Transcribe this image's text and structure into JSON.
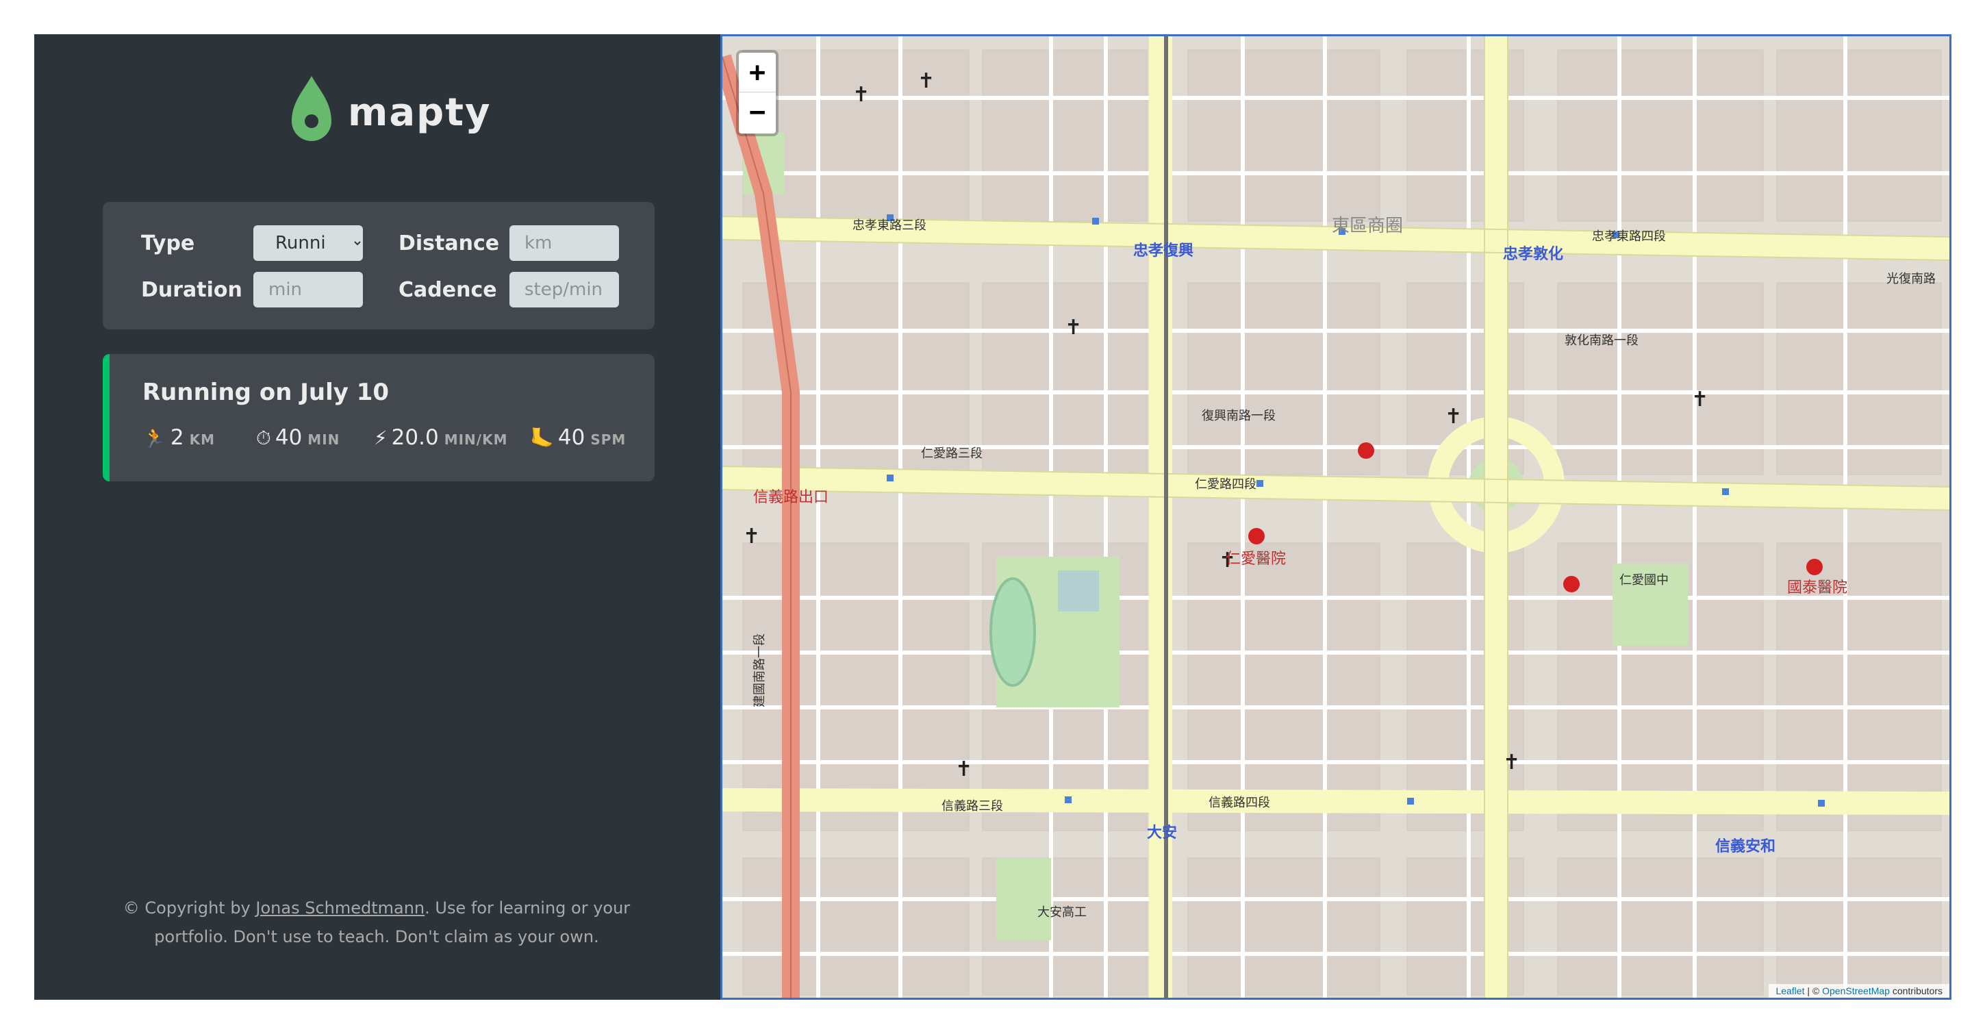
{
  "brand": {
    "name": "mapty",
    "accent": "#00c46a",
    "logo_color": "#66b96d"
  },
  "form": {
    "type_label": "Type",
    "type_value": "Runni",
    "distance_label": "Distance",
    "distance_placeholder": "km",
    "duration_label": "Duration",
    "duration_placeholder": "min",
    "cadence_label": "Cadence",
    "cadence_placeholder": "step/min"
  },
  "workout": {
    "title": "Running on July 10",
    "details": [
      {
        "icon": "runner-icon",
        "glyph": "🏃",
        "value": "2",
        "unit": "KM"
      },
      {
        "icon": "stopwatch-icon",
        "glyph": "⏱",
        "value": "40",
        "unit": "MIN"
      },
      {
        "icon": "lightning-icon",
        "glyph": "⚡",
        "value": "20.0",
        "unit": "MIN/KM"
      },
      {
        "icon": "footprint-icon",
        "glyph": "🦶",
        "value": "40",
        "unit": "SPM"
      }
    ]
  },
  "footer": {
    "prefix": "© Copyright by ",
    "author": "Jonas Schmedtmann",
    "suffix": ". Use for learning or your portfolio. Don't use to teach. Don't claim as your own."
  },
  "map": {
    "zoom_in": "+",
    "zoom_out": "−",
    "attribution_leaflet": "Leaflet",
    "attribution_sep": " | © ",
    "attribution_osm": "OpenStreetMap",
    "attribution_suffix": " contributors",
    "labels": {
      "l1": "忠孝東路三段",
      "l2": "忠孝東路四段",
      "l3": "忠孝復興",
      "l4": "忠孝敦化",
      "l5": "東區商圈",
      "l6": "仁愛路三段",
      "l7": "仁愛路四段",
      "l8": "信義路三段",
      "l9": "信義路四段",
      "l10": "大安",
      "l11": "信義安和",
      "l12": "仁愛醫院",
      "l13": "國泰醫院",
      "l14": "大安高工",
      "l15": "信義路出口",
      "l16": "仁愛國中",
      "l17": "敦化南路一段",
      "l18": "復興南路一段",
      "l19": "建國南路一段",
      "l20": "光復南路"
    }
  }
}
